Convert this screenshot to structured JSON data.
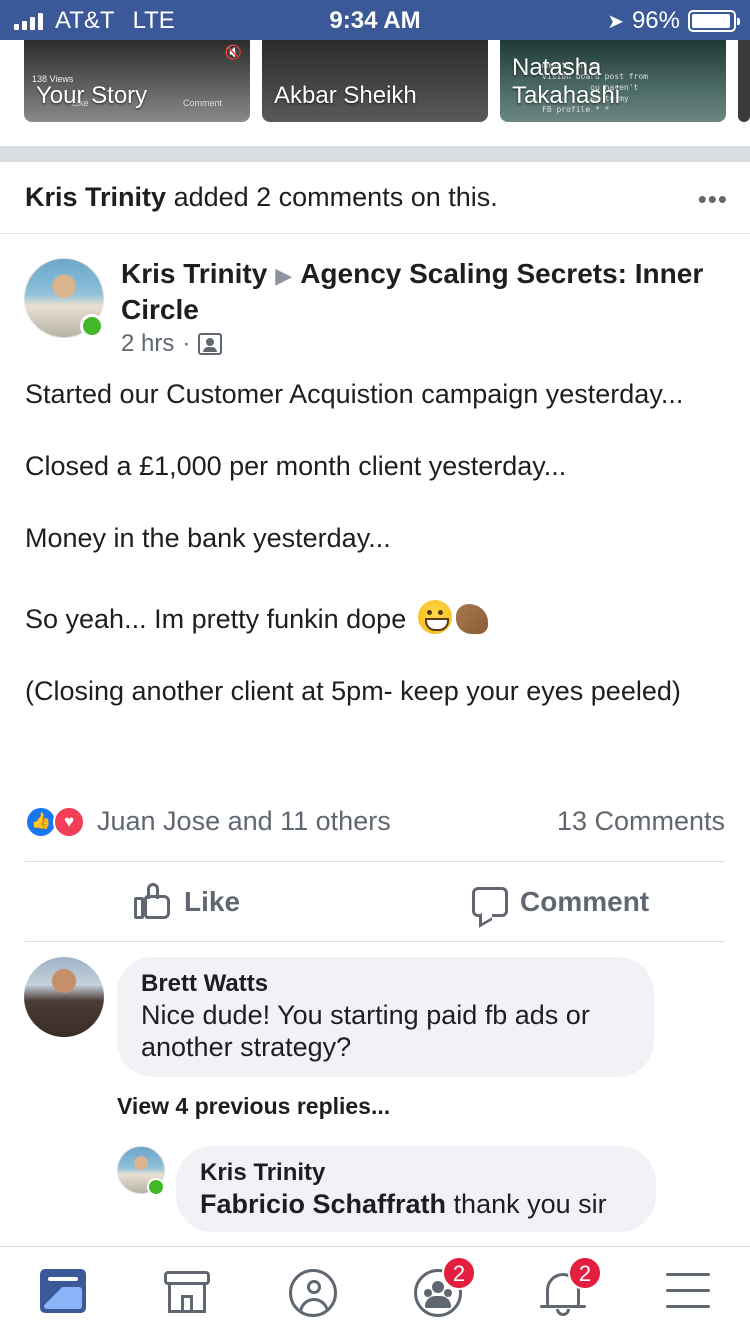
{
  "status_bar": {
    "carrier": "AT&T",
    "network": "LTE",
    "time": "9:34 AM",
    "battery": "96%",
    "battery_level": 0.96
  },
  "stories": [
    {
      "name": "Your Story",
      "views": "138 Views",
      "like": "Like",
      "comment": "Comment"
    },
    {
      "name": "Akbar Sheikh"
    },
    {
      "name": "Natasha Takahashi",
      "overlay_text": "mments on my\nvision board post from\n          ou haven't\n          ed to my\nFB profile * *"
    }
  ],
  "activity": {
    "actor": "Kris Trinity",
    "text": "added 2 comments on this.",
    "more": "•••"
  },
  "post": {
    "author": "Kris Trinity",
    "group": "Agency Scaling Secrets: Inner Circle",
    "time": "2 hrs",
    "separator": "·",
    "lines": [
      "Started our Customer Acquistion campaign yesterday...",
      "Closed a £1,000 per month client yesterday...",
      "Money in the bank yesterday...",
      "So yeah... Im pretty funkin dope",
      "(Closing another client at 5pm- keep your eyes peeled)"
    ],
    "reactions_text": "Juan Jose and 11 others",
    "comments_count": "13 Comments"
  },
  "actions": {
    "like": "Like",
    "comment": "Comment"
  },
  "comments": [
    {
      "author": "Brett Watts",
      "text": "Nice dude! You starting paid fb ads or another strategy?"
    }
  ],
  "view_replies": "View 4 previous replies...",
  "reply": {
    "author": "Kris Trinity",
    "mention": "Fabricio Schaffrath",
    "text": " thank you sir"
  },
  "bottom_nav": {
    "items": [
      "news-feed",
      "marketplace",
      "profile",
      "groups",
      "notifications",
      "menu"
    ],
    "groups_badge": "2",
    "notifications_badge": "2"
  },
  "colors": {
    "brand": "#3b5998",
    "badge": "#e41e3f",
    "online": "#42b72a",
    "like": "#1877f2",
    "love": "#f33e58"
  }
}
